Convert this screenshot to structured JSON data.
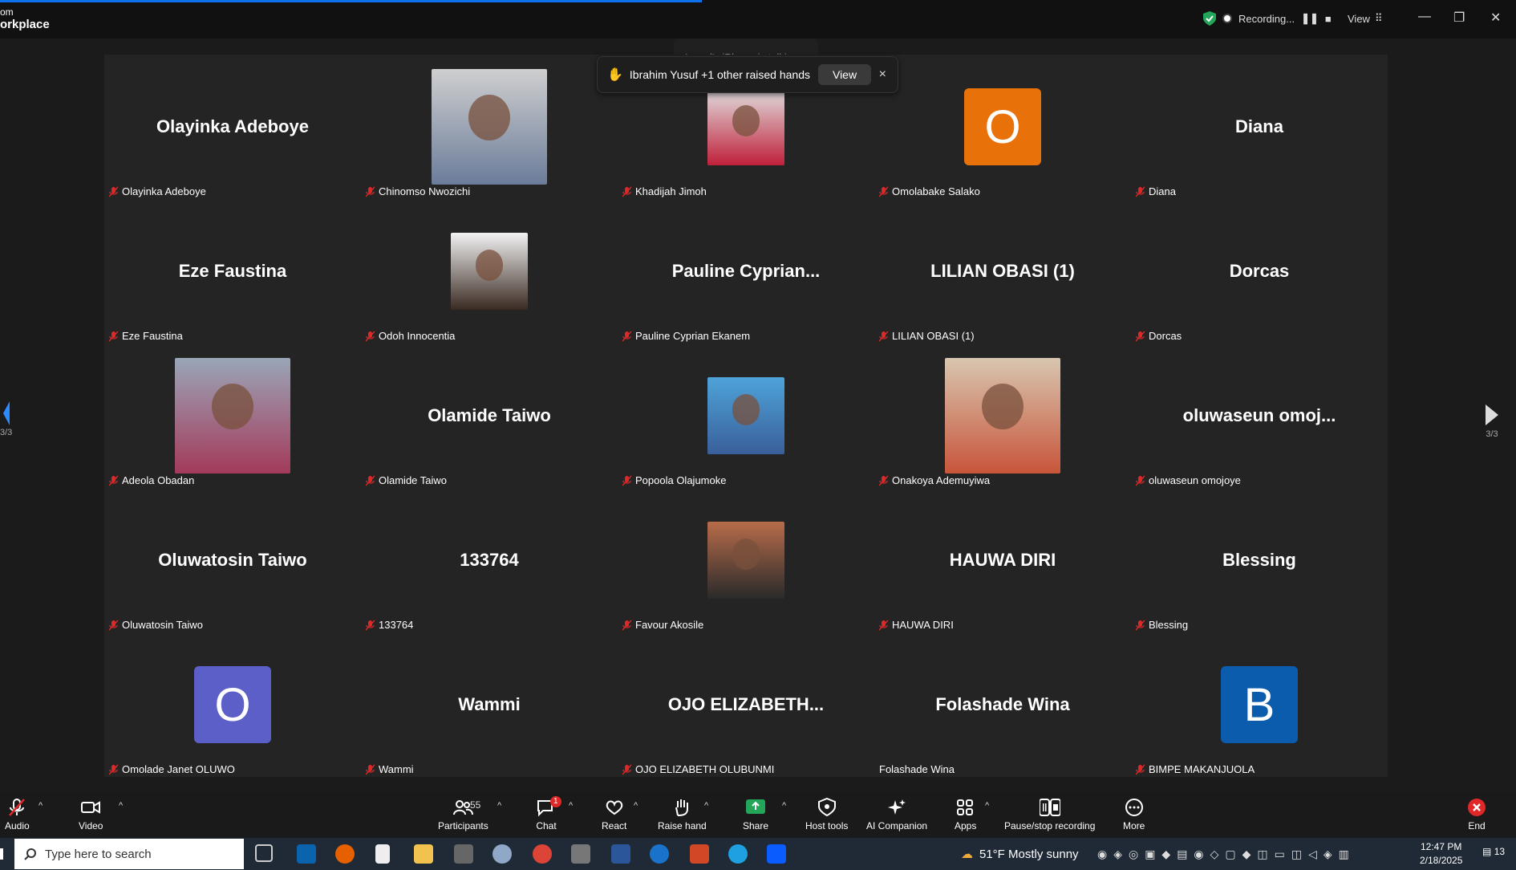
{
  "app": {
    "brand_line1": "om",
    "brand_line2": "orkplace"
  },
  "topbar": {
    "recording_label": "Recording...",
    "view_label": "View"
  },
  "talking_banner": "Lawal's iPhone is talking...",
  "raised_hands": {
    "text": "Ibrahim Yusuf +1 other raised hands",
    "view_label": "View",
    "close": "×"
  },
  "nav": {
    "page_left": "3/3",
    "page_right": "3/3"
  },
  "tiles": [
    {
      "big": "Olayinka Adeboye",
      "label": "Olayinka Adeboye",
      "kind": "name",
      "muted": true
    },
    {
      "big": "",
      "label": "Chinomso Nwozichi",
      "kind": "photo",
      "muted": true
    },
    {
      "big": "",
      "label": "Khadijah Jimoh",
      "kind": "photo",
      "muted": true
    },
    {
      "big": "O",
      "label": "Omolabake Salako",
      "kind": "avatar",
      "color": "#e8710a",
      "muted": true
    },
    {
      "big": "Diana",
      "label": "Diana",
      "kind": "name",
      "muted": true
    },
    {
      "big": "Eze Faustina",
      "label": "Eze Faustina",
      "kind": "name",
      "muted": true
    },
    {
      "big": "",
      "label": "Odoh Innocentia",
      "kind": "photo",
      "muted": true
    },
    {
      "big": "Pauline  Cyprian...",
      "label": "Pauline Cyprian Ekanem",
      "kind": "name",
      "muted": true
    },
    {
      "big": "LILIAN OBASI (1)",
      "label": "LILIAN OBASI (1)",
      "kind": "name",
      "muted": true
    },
    {
      "big": "Dorcas",
      "label": "Dorcas",
      "kind": "name",
      "muted": true
    },
    {
      "big": "",
      "label": "Adeola Obadan",
      "kind": "photo",
      "muted": true
    },
    {
      "big": "Olamide Taiwo",
      "label": "Olamide Taiwo",
      "kind": "name",
      "muted": true
    },
    {
      "big": "",
      "label": "Popoola Olajumoke",
      "kind": "photo",
      "muted": true
    },
    {
      "big": "",
      "label": "Onakoya Ademuyiwa",
      "kind": "photo",
      "muted": true
    },
    {
      "big": "oluwaseun  omoj...",
      "label": "oluwaseun omojoye",
      "kind": "name",
      "muted": true
    },
    {
      "big": "Oluwatosin Taiwo",
      "label": "Oluwatosin Taiwo",
      "kind": "name",
      "muted": true
    },
    {
      "big": "133764",
      "label": "133764",
      "kind": "name",
      "muted": true
    },
    {
      "big": "",
      "label": "Favour Akosile",
      "kind": "photo",
      "muted": true
    },
    {
      "big": "HAUWA DIRI",
      "label": "HAUWA DIRI",
      "kind": "name",
      "muted": true
    },
    {
      "big": "Blessing",
      "label": "Blessing",
      "kind": "name",
      "muted": true
    },
    {
      "big": "O",
      "label": "Omolade Janet OLUWO",
      "kind": "avatar",
      "color": "#5b5fc7",
      "muted": true
    },
    {
      "big": "Wammi",
      "label": "Wammi",
      "kind": "name",
      "muted": true
    },
    {
      "big": "OJO  ELIZABETH...",
      "label": "OJO ELIZABETH OLUBUNMI",
      "kind": "name",
      "muted": true
    },
    {
      "big": "Folashade Wina",
      "label": "Folashade Wina",
      "kind": "name",
      "muted": false
    },
    {
      "big": "B",
      "label": "BIMPE MAKANJUOLA",
      "kind": "avatar",
      "color": "#0b5cad",
      "muted": true
    }
  ],
  "toolbar": {
    "audio": "Audio",
    "video": "Video",
    "participants": "Participants",
    "participants_count": "55",
    "chat": "Chat",
    "chat_badge": "1",
    "react": "React",
    "raise_hand": "Raise hand",
    "share": "Share",
    "host_tools": "Host tools",
    "ai_companion": "AI Companion",
    "apps": "Apps",
    "pause_stop": "Pause/stop recording",
    "more": "More",
    "end": "End"
  },
  "taskbar": {
    "search_placeholder": "Type here to search",
    "weather": "51°F  Mostly sunny",
    "time": "12:47 PM",
    "date": "2/18/2025",
    "notif_count": "13"
  }
}
